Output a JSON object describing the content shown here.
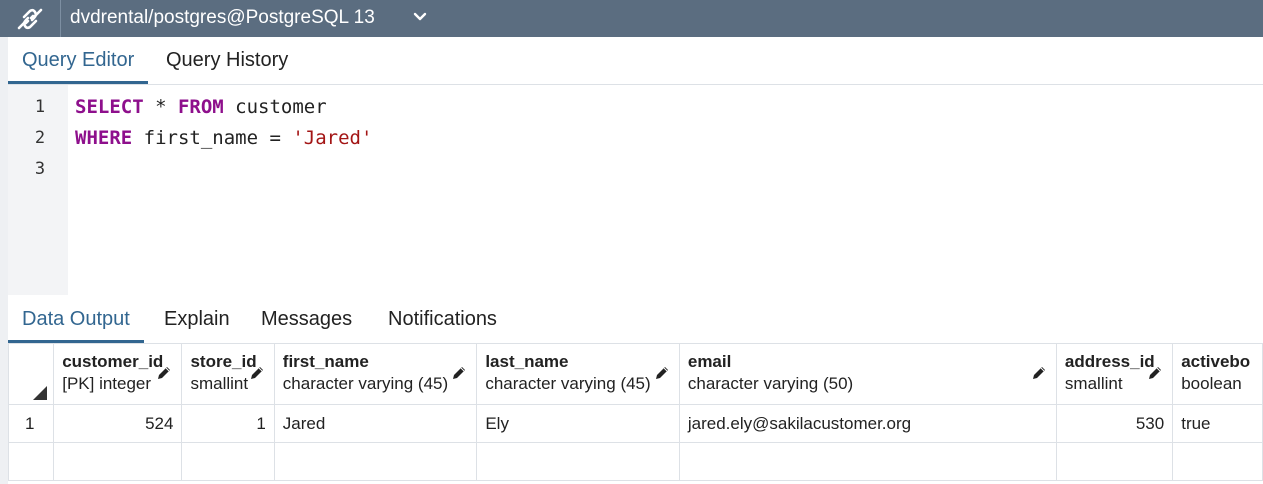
{
  "window": {
    "title": "dvdrental/postgres@PostgreSQL 13"
  },
  "editor_tabs": [
    {
      "label": "Query Editor",
      "active": true
    },
    {
      "label": "Query History",
      "active": false
    }
  ],
  "editor": {
    "line_numbers": [
      "1",
      "2",
      "3"
    ],
    "lines": [
      [
        {
          "t": "SELECT",
          "c": "kw"
        },
        {
          "t": " * ",
          "c": ""
        },
        {
          "t": "FROM",
          "c": "kw"
        },
        {
          "t": " customer",
          "c": ""
        }
      ],
      [
        {
          "t": "WHERE",
          "c": "kw"
        },
        {
          "t": " first_name = ",
          "c": ""
        },
        {
          "t": "'Jared'",
          "c": "str"
        }
      ],
      []
    ]
  },
  "output_tabs": [
    {
      "label": "Data Output",
      "active": true
    },
    {
      "label": "Explain",
      "active": false
    },
    {
      "label": "Messages",
      "active": false
    },
    {
      "label": "Notifications",
      "active": false
    }
  ],
  "results": {
    "columns": [
      {
        "name": "customer_id",
        "type": "[PK] integer",
        "editable": true
      },
      {
        "name": "store_id",
        "type": "smallint",
        "editable": true
      },
      {
        "name": "first_name",
        "type": "character varying (45)",
        "editable": true
      },
      {
        "name": "last_name",
        "type": "character varying (45)",
        "editable": true
      },
      {
        "name": "email",
        "type": "character varying (50)",
        "editable": true
      },
      {
        "name": "address_id",
        "type": "smallint",
        "editable": true
      },
      {
        "name": "activebo",
        "type": "boolean",
        "editable": false
      }
    ],
    "rows": [
      {
        "row_number": "1",
        "cells": [
          "524",
          "1",
          "Jared",
          "Ely",
          "jared.ely@sakilacustomer.org",
          "530",
          "true"
        ]
      }
    ]
  },
  "colors": {
    "topbar": "#5b6d80",
    "accent": "#326690",
    "keyword": "#8e0f8c",
    "string": "#a31515"
  }
}
